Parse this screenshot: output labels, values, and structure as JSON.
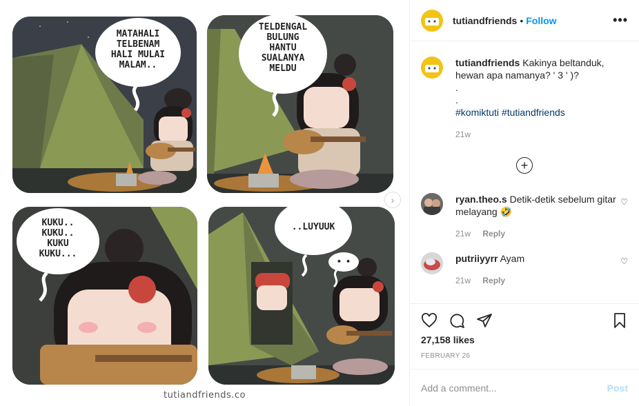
{
  "comic": {
    "panel1_text": "MATAHALI\nTELBENAM\nHALI MULAI\nMALAM..",
    "panel2_text": "TELDENGAL\nBULUNG\nHANTU\nSUALANYA\nMELDU",
    "panel3_text": "KUKU..\nKUKU..\nKUKU\nKUKU...",
    "panel4_text": "..LUYUUK",
    "panel4_small": "• •",
    "credit": "tutiandfriends.co"
  },
  "header": {
    "username": "tutiandfriends",
    "separator": "•",
    "follow_label": "Follow",
    "more_label": "•••"
  },
  "caption": {
    "username": "tutiandfriends",
    "text": "Kakinya beltanduk, hewan apa namanya? ' 3 ' )?",
    "line2": ".",
    "line3": ".",
    "hashtag1": "#komiktuti",
    "hashtag2": "#tutiandfriends",
    "time": "21w"
  },
  "comments": [
    {
      "username": "ryan.theo.s",
      "text": "Detik-detik sebelum gitar melayang 🤣",
      "time": "21w",
      "reply_label": "Reply"
    },
    {
      "username": "putriiyyrr",
      "text": "Ayam",
      "time": "21w",
      "reply_label": "Reply"
    }
  ],
  "post": {
    "likes": "27,158 likes",
    "date": "FEBRUARY 26"
  },
  "add_comment": {
    "placeholder": "Add a comment...",
    "post_label": "Post"
  },
  "colors": {
    "accent": "#0095f6",
    "hashtag": "#00376b",
    "post_disabled": "#b2dffc"
  }
}
